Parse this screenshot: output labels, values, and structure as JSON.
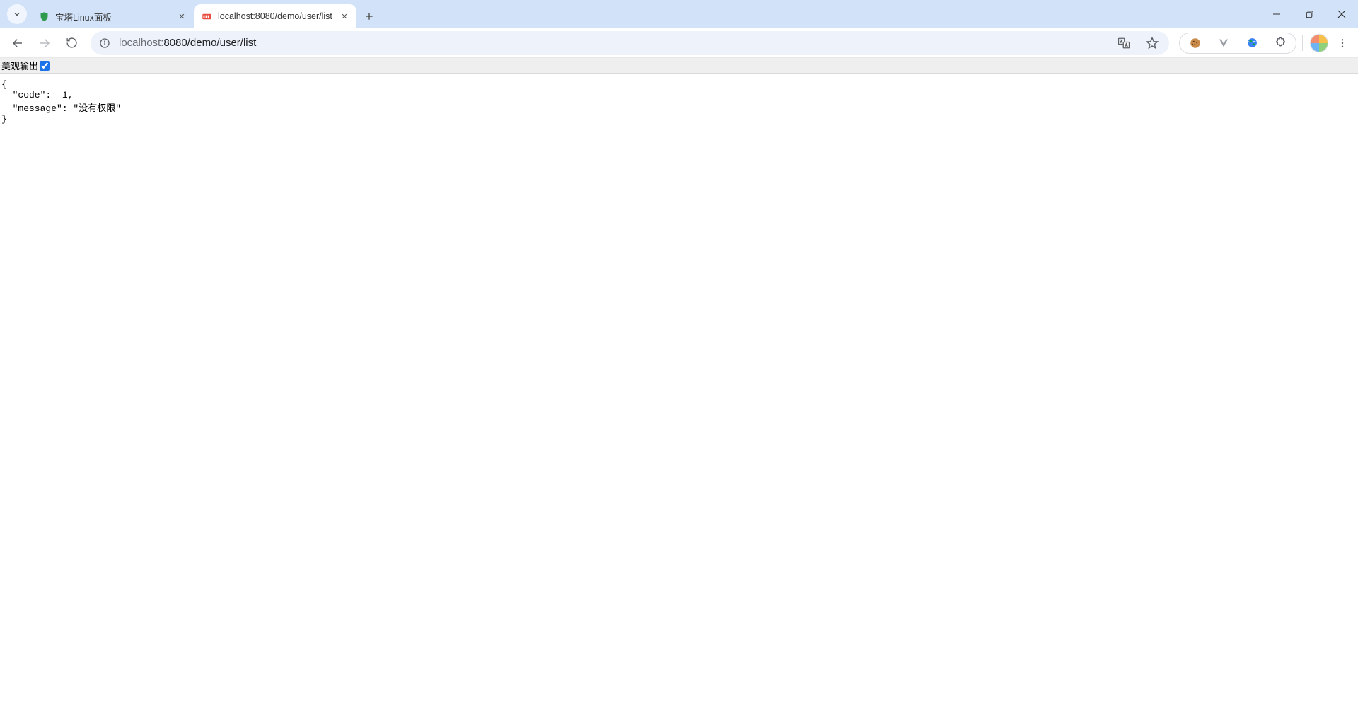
{
  "window": {
    "tabs": [
      {
        "title": "宝塔Linux面板",
        "active": false,
        "favicon": "shield-green"
      },
      {
        "title": "localhost:8080/demo/user/list",
        "active": true,
        "favicon": "json-red"
      }
    ]
  },
  "toolbar": {
    "url_host": "localhost:",
    "url_port_path": "8080/demo/user/list"
  },
  "json_viewer": {
    "pretty_label": "美观输出",
    "pretty_checked": true
  },
  "response": {
    "raw": "{\n  \"code\": -1,\n  \"message\": \"没有权限\"\n}",
    "code": -1,
    "message": "没有权限"
  }
}
